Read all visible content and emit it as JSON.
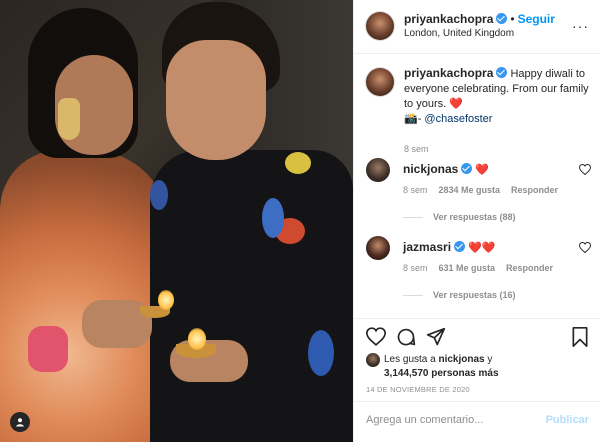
{
  "post": {
    "author": "priyankachopra",
    "follow_label": "Seguir",
    "separator": "•",
    "location": "London, United Kingdom",
    "more_label": "···"
  },
  "caption": {
    "username": "priyankachopra",
    "text": "Happy diwali to everyone celebrating. From our family to yours. ❤️",
    "credit_prefix": "📸- ",
    "credit_mention": "@chasefoster",
    "age": "8 sem"
  },
  "comments": [
    {
      "username": "nickjonas",
      "text": "❤️",
      "age": "8 sem",
      "likes": "2834 Me gusta",
      "reply_label": "Responder",
      "replies_label": "Ver respuestas (88)"
    },
    {
      "username": "jazmasri",
      "text": "❤️❤️",
      "age": "8 sem",
      "likes": "631 Me gusta",
      "reply_label": "Responder",
      "replies_label": "Ver respuestas (16)"
    }
  ],
  "likes_summary": {
    "prefix": "Les gusta a ",
    "user": "nickjonas",
    "middle": " y",
    "count": "3,144,570 personas más"
  },
  "date": "14 DE NOVIEMBRE DE 2020",
  "add_comment": {
    "placeholder": "Agrega un comentario...",
    "publish_label": "Publicar"
  },
  "icons": {
    "like": "heart-icon",
    "comment": "comment-icon",
    "share": "paper-plane-icon",
    "save": "bookmark-icon",
    "tag": "person-tag-icon"
  },
  "colors": {
    "link_blue": "#0095f6",
    "heart_red": "#ed4956",
    "verified_blue": "#3897f0",
    "muted": "#8e8e8e"
  }
}
